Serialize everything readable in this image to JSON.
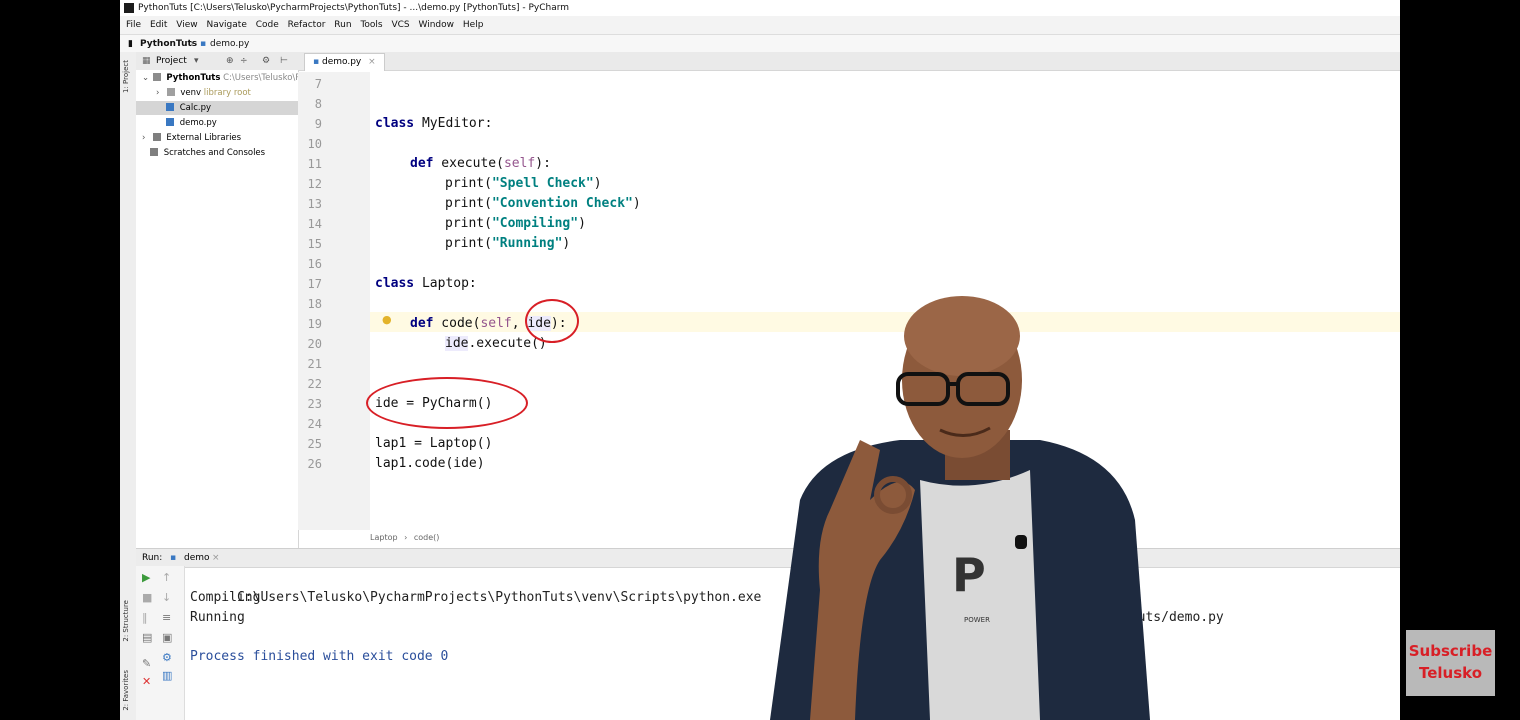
{
  "window": {
    "title": "PythonTuts [C:\\Users\\Telusko\\PycharmProjects\\PythonTuts] - ...\\demo.py [PythonTuts] - PyCharm"
  },
  "menu": [
    "File",
    "Edit",
    "View",
    "Navigate",
    "Code",
    "Refactor",
    "Run",
    "Tools",
    "VCS",
    "Window",
    "Help"
  ],
  "navbar": {
    "project": "PythonTuts",
    "file": "demo.py"
  },
  "side_tabs": {
    "project": "1: Project",
    "structure": "2: Structure",
    "favorites": "2: Favorites"
  },
  "project_panel": {
    "header": "Project",
    "items": [
      {
        "label": "PythonTuts",
        "hint": "C:\\Users\\Telusko\\Py"
      },
      {
        "label": "venv",
        "hint": "library root"
      },
      {
        "label": "Calc.py",
        "hint": ""
      },
      {
        "label": "demo.py",
        "hint": ""
      },
      {
        "label": "External Libraries",
        "hint": ""
      },
      {
        "label": "Scratches and Consoles",
        "hint": ""
      }
    ]
  },
  "editor": {
    "tab": "demo.py",
    "line_numbers": [
      "7",
      "8",
      "9",
      "10",
      "11",
      "12",
      "13",
      "14",
      "15",
      "16",
      "17",
      "18",
      "19",
      "20",
      "21",
      "22",
      "23",
      "24",
      "25",
      "26"
    ],
    "code": {
      "l9_kw": "class",
      "l9_rest": " MyEditor:",
      "l11_kw": "def",
      "l11_name": " execute(",
      "l11_self": "self",
      "l11_end": "):",
      "l12_a": "print(",
      "l12_s": "\"Spell Check\"",
      "l12_b": ")",
      "l13_a": "print(",
      "l13_s": "\"Convention Check\"",
      "l13_b": ")",
      "l14_a": "print(",
      "l14_s": "\"Compiling\"",
      "l14_b": ")",
      "l15_a": "print(",
      "l15_s": "\"Running\"",
      "l15_b": ")",
      "l17_kw": "class",
      "l17_rest": " Laptop:",
      "l19_kw": "def",
      "l19_name": " code(",
      "l19_self": "self",
      "l19_comma": ", ",
      "l19_param": "ide",
      "l19_end": "):",
      "l20_var": "ide",
      "l20_rest": ".execute()",
      "l23": "ide = PyCharm()",
      "l25": "lap1 = Laptop()",
      "l26": "lap1.code(ide)"
    },
    "breadcrumbs": [
      "Laptop",
      "code()"
    ]
  },
  "run_panel": {
    "label": "Run:",
    "tab": "demo",
    "output": [
      "C:\\Users\\Telusko\\PycharmProjects\\PythonTuts\\venv\\Scripts\\python.exe",
      "Compiling",
      "Running",
      "Process finished with exit code 0"
    ],
    "path_tail": "nTuts/demo.py"
  },
  "overlay": {
    "subscribe": "Subscribe",
    "channel": "Telusko",
    "shirt_letter": "P",
    "shirt_text": "POWER"
  },
  "colors": {
    "keyword": "#000080",
    "string": "#008080",
    "self": "#94558d",
    "annotation": "#d81f26"
  }
}
